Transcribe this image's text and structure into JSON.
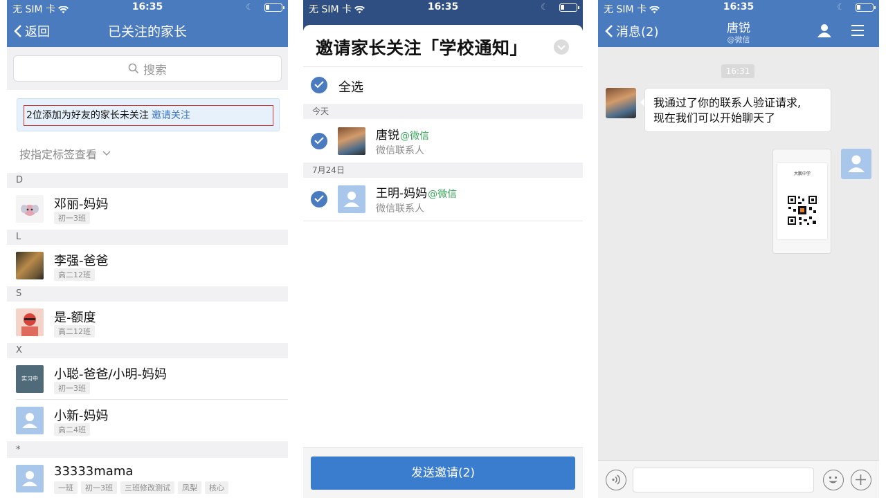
{
  "status": {
    "carrier": "无 SIM 卡",
    "time": "16:35"
  },
  "panel1": {
    "back_label": "返回",
    "title": "已关注的家长",
    "search_placeholder": "搜索",
    "notice_text": "2位添加为好友的家长未关注",
    "notice_link": "邀请关注",
    "tag_filter": "按指定标签查看",
    "sections": [
      "D",
      "L",
      "S",
      "X",
      "*"
    ],
    "contacts": [
      {
        "name": "邓丽-妈妈",
        "tags": [
          "初一3班"
        ]
      },
      {
        "name": "李强-爸爸",
        "tags": [
          "高二12班"
        ]
      },
      {
        "name": "是-额度",
        "tags": [
          "高二12班"
        ]
      },
      {
        "name": "小聪-爸爸/小明-妈妈",
        "tags": [
          "初一3班"
        ],
        "avatar_text": "实习中"
      },
      {
        "name": "小新-妈妈",
        "tags": [
          "高二4班"
        ]
      },
      {
        "name": "33333mama",
        "tags": [
          "一班",
          "初一3班",
          "三班修改测试",
          "凤梨",
          "核心"
        ]
      }
    ]
  },
  "panel2": {
    "title": "邀请家长关注「学校通知」",
    "select_all": "全选",
    "sections": [
      "今天",
      "7月24日"
    ],
    "contacts": [
      {
        "name": "唐锐",
        "source": "@微信",
        "sub": "微信联系人"
      },
      {
        "name": "王明-妈妈",
        "source": "@微信",
        "sub": "微信联系人"
      }
    ],
    "send_button": "发送邀请(2)"
  },
  "panel3": {
    "back_label": "消息(2)",
    "chat_name": "唐锐",
    "chat_sub": "@微信",
    "time_chip": "16:31",
    "message_line1": "我通过了你的联系人验证请求,",
    "message_line2": "现在我们可以开始聊天了",
    "card_title": "大鹏中学"
  },
  "colors": {
    "nav_blue": "#4b7bbf",
    "accent_green": "#3ba55c",
    "button_blue": "#3a7dcf",
    "alert_red": "#d7332e"
  }
}
